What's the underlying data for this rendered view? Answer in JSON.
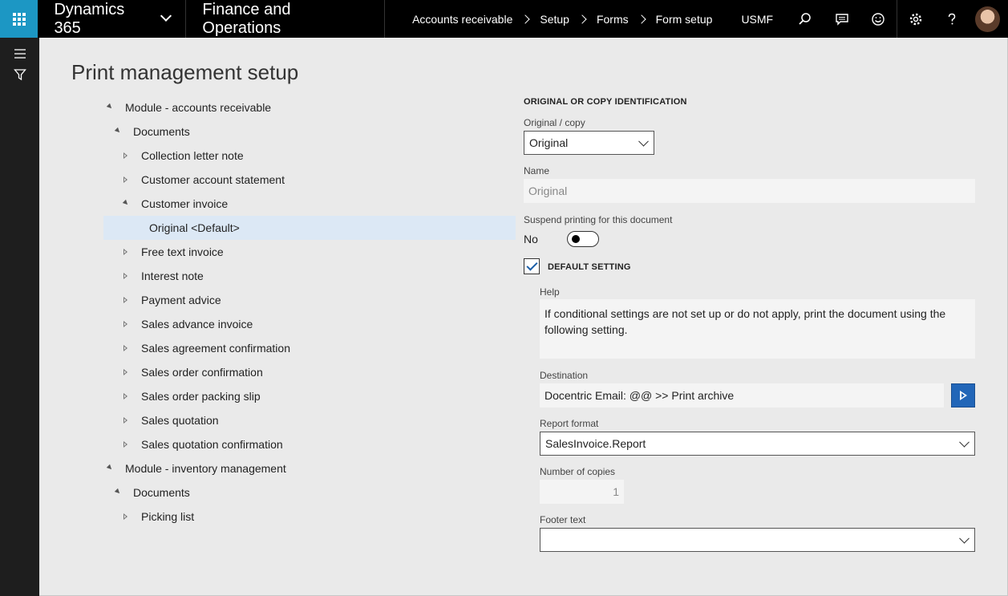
{
  "topbar": {
    "brand": "Dynamics 365",
    "product": "Finance and Operations",
    "breadcrumb": [
      "Accounts receivable",
      "Setup",
      "Forms",
      "Form setup"
    ],
    "company": "USMF"
  },
  "page": {
    "title": "Print management setup"
  },
  "tree": [
    {
      "label": "Module - accounts receivable",
      "level": 0,
      "state": "open"
    },
    {
      "label": "Documents",
      "level": 1,
      "state": "open"
    },
    {
      "label": "Collection letter note",
      "level": 2,
      "state": "closed"
    },
    {
      "label": "Customer account statement",
      "level": 2,
      "state": "closed"
    },
    {
      "label": "Customer invoice",
      "level": 2,
      "state": "open"
    },
    {
      "label": "Original <Default>",
      "level": 3,
      "state": "leaf",
      "selected": true
    },
    {
      "label": "Free text invoice",
      "level": 2,
      "state": "closed"
    },
    {
      "label": "Interest note",
      "level": 2,
      "state": "closed"
    },
    {
      "label": "Payment advice",
      "level": 2,
      "state": "closed"
    },
    {
      "label": "Sales advance invoice",
      "level": 2,
      "state": "closed"
    },
    {
      "label": "Sales agreement confirmation",
      "level": 2,
      "state": "closed"
    },
    {
      "label": "Sales order confirmation",
      "level": 2,
      "state": "closed"
    },
    {
      "label": "Sales order packing slip",
      "level": 2,
      "state": "closed"
    },
    {
      "label": "Sales quotation",
      "level": 2,
      "state": "closed"
    },
    {
      "label": "Sales quotation confirmation",
      "level": 2,
      "state": "closed"
    },
    {
      "label": "Module - inventory management",
      "level": 0,
      "state": "open"
    },
    {
      "label": "Documents",
      "level": 1,
      "state": "open"
    },
    {
      "label": "Picking list",
      "level": 2,
      "state": "closed"
    }
  ],
  "form": {
    "section_title": "ORIGINAL OR COPY IDENTIFICATION",
    "original_copy_label": "Original / copy",
    "original_copy_value": "Original",
    "name_label": "Name",
    "name_value": "Original",
    "suspend_label": "Suspend printing for this document",
    "suspend_value": "No",
    "default_setting_label": "DEFAULT SETTING",
    "help_label": "Help",
    "help_text": "If conditional settings are not set up or do not apply, print the document using the following setting.",
    "destination_label": "Destination",
    "destination_value": "Docentric Email: @@ >> Print archive",
    "report_format_label": "Report format",
    "report_format_value": "SalesInvoice.Report",
    "copies_label": "Number of copies",
    "copies_value": "1",
    "footer_label": "Footer text",
    "footer_value": ""
  },
  "colors": {
    "accent": "#1c97c4",
    "topbar": "#000000",
    "selection": "#dce8f5",
    "button": "#2266b8"
  }
}
